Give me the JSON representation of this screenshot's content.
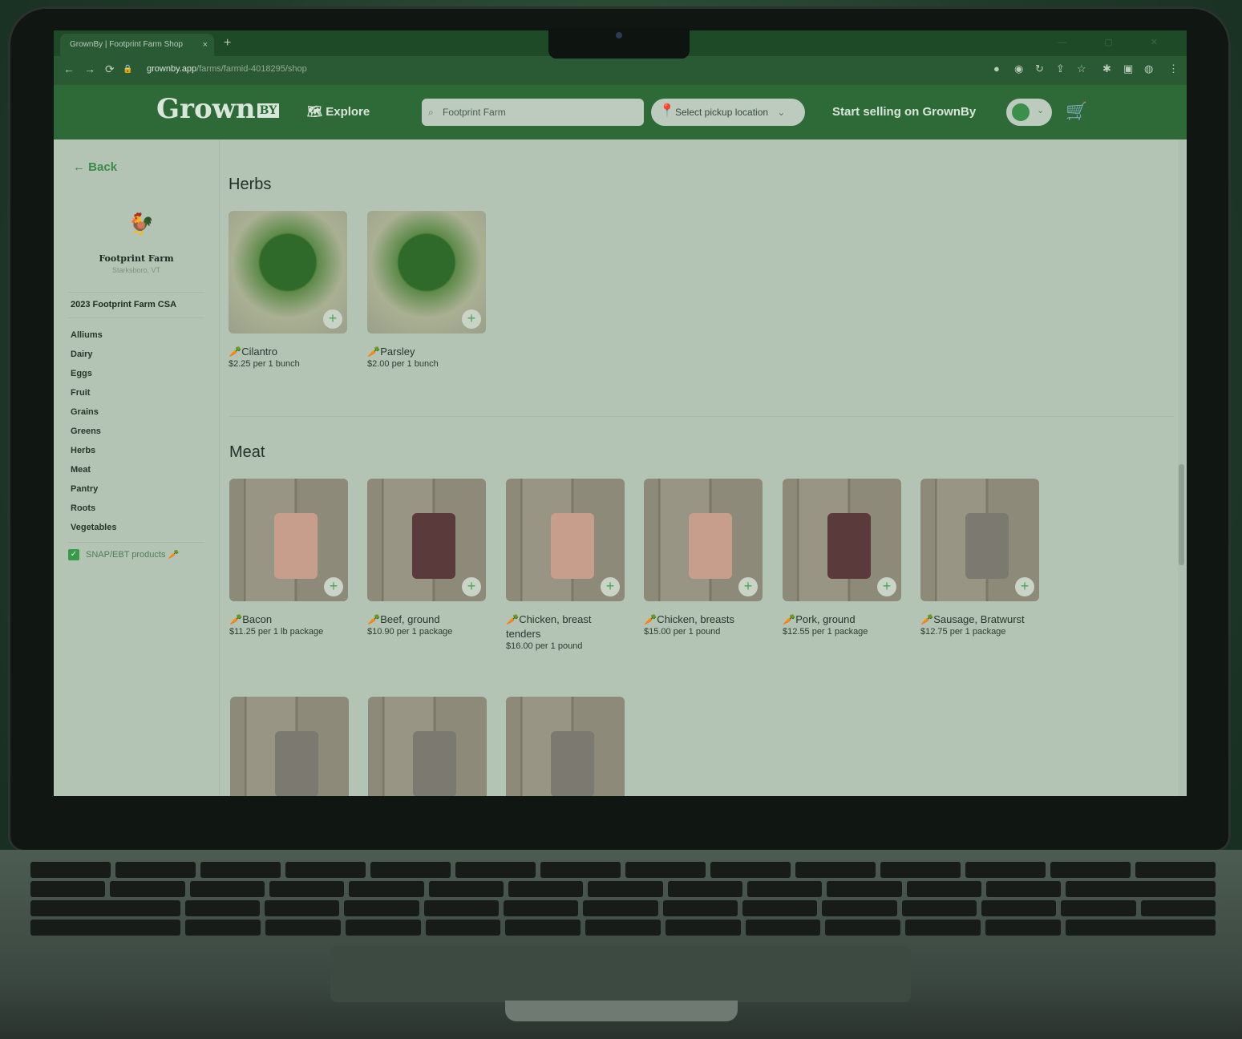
{
  "browser": {
    "tab_title": "GrownBy | Footprint Farm Shop",
    "tab_close": "×",
    "new_tab": "+",
    "url_host": "grownby.app",
    "url_path": "/farms/farmid-4018295/shop"
  },
  "header": {
    "logo_main": "Grown",
    "logo_by": "BY",
    "explore_label": "Explore",
    "search_value": "Footprint Farm",
    "pickup_label": "Select pickup location",
    "sell_label": "Start selling on GrownBy",
    "brand_color": "#2d6a38"
  },
  "sidebar": {
    "back_label": "Back",
    "farm_name": "Footprint Farm",
    "farm_location": "Starksboro, VT",
    "csa_label": "2023 Footprint Farm CSA",
    "categories": [
      "Alliums",
      "Dairy",
      "Eggs",
      "Fruit",
      "Grains",
      "Greens",
      "Herbs",
      "Meat",
      "Pantry",
      "Roots",
      "Vegetables"
    ],
    "snap_label": "SNAP/EBT products",
    "snap_checked": true
  },
  "sections": {
    "herbs": {
      "title": "Herbs",
      "products": [
        {
          "name": "Cilantro",
          "price": "$2.25 per 1 bunch"
        },
        {
          "name": "Parsley",
          "price": "$2.00 per 1 bunch"
        }
      ]
    },
    "meat": {
      "title": "Meat",
      "products": [
        {
          "name": "Bacon",
          "price": "$11.25 per 1 lb package"
        },
        {
          "name": "Beef, ground",
          "price": "$10.90 per 1 package"
        },
        {
          "name": "Chicken, breast tenders",
          "price": "$16.00 per 1 pound"
        },
        {
          "name": "Chicken, breasts",
          "price": "$15.00 per 1 pound"
        },
        {
          "name": "Pork, ground",
          "price": "$12.55 per 1 package"
        },
        {
          "name": "Sausage, Bratwurst",
          "price": "$12.75 per 1 package"
        }
      ]
    }
  }
}
